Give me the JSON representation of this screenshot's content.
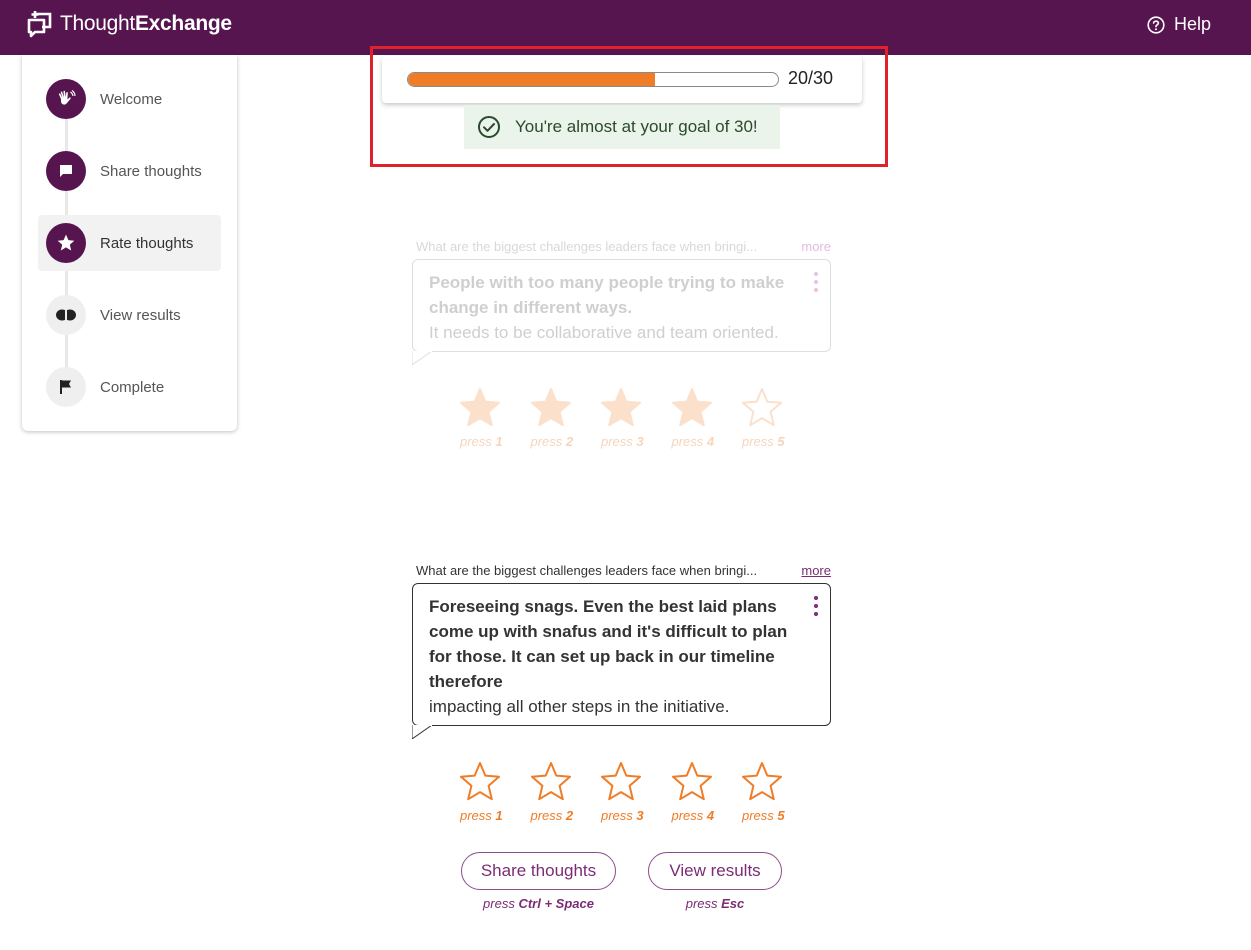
{
  "header": {
    "logo_light": "Thought",
    "logo_bold": "Exchange",
    "help_label": "Help"
  },
  "sidebar": {
    "steps": [
      {
        "label": "Welcome",
        "icon": "waving-hand-icon",
        "state": "done"
      },
      {
        "label": "Share thoughts",
        "icon": "chat-bubble-icon",
        "state": "done"
      },
      {
        "label": "Rate thoughts",
        "icon": "star-icon",
        "state": "active"
      },
      {
        "label": "View results",
        "icon": "view-results-icon",
        "state": "todo"
      },
      {
        "label": "Complete",
        "icon": "flag-icon",
        "state": "todo"
      }
    ]
  },
  "progress": {
    "current": 20,
    "goal": 30,
    "count_text": "20/30",
    "goal_message": "You're almost at your goal of 30!"
  },
  "thoughts": [
    {
      "prompt": "What are the biggest challenges leaders face when bringi...",
      "more_label": "more",
      "bold_text": "People with too many people trying to make change in different ways.",
      "regular_text": "It needs to be collaborative and team oriented.",
      "rating": 4,
      "star_labels": [
        {
          "prefix": "press",
          "key": "1"
        },
        {
          "prefix": "press",
          "key": "2"
        },
        {
          "prefix": "press",
          "key": "3"
        },
        {
          "prefix": "press",
          "key": "4"
        },
        {
          "prefix": "press",
          "key": "5"
        }
      ]
    },
    {
      "prompt": "What are the biggest challenges leaders face when bringi...",
      "more_label": "more",
      "bold_text": "Foreseeing snags. Even the best laid plans come up with snafus and it's difficult to plan for those. It can set up back in our timeline therefore",
      "regular_text": "impacting all other steps in the initiative.",
      "rating": 0,
      "star_labels": [
        {
          "prefix": "press",
          "key": "1"
        },
        {
          "prefix": "press",
          "key": "2"
        },
        {
          "prefix": "press",
          "key": "3"
        },
        {
          "prefix": "press",
          "key": "4"
        },
        {
          "prefix": "press",
          "key": "5"
        }
      ]
    }
  ],
  "actions": {
    "share_label": "Share thoughts",
    "share_hint_prefix": "press",
    "share_hint_key": "Ctrl + Space",
    "results_label": "View results",
    "results_hint_prefix": "press",
    "results_hint_key": "Esc"
  },
  "colors": {
    "brand": "#57154f",
    "accent": "#ef7d28",
    "highlight": "#e0202a",
    "success_bg": "#eaf4ea"
  }
}
